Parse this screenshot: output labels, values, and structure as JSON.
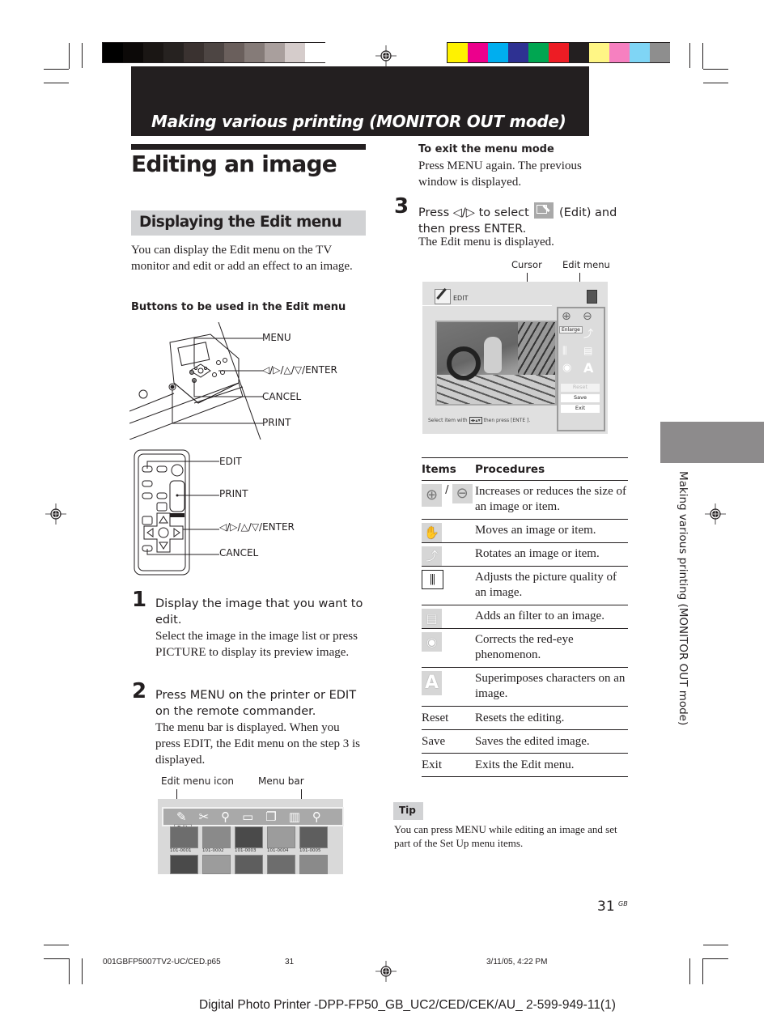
{
  "header": {
    "banner_title": "Making various printing (MONITOR OUT mode)",
    "gray_swatches": [
      "#000000",
      "#0c0908",
      "#1a1614",
      "#262220",
      "#3a3230",
      "#4d4543",
      "#6a5f5c",
      "#857b78",
      "#a99f9d",
      "#d5cccb",
      "#ffffff"
    ],
    "color_swatches": [
      "#fff200",
      "#ec008c",
      "#00aeef",
      "#2e3192",
      "#00a651",
      "#ed1c24",
      "#231f20",
      "#fff685",
      "#f680c0",
      "#7fd5f5",
      "#8e8e8e"
    ]
  },
  "left": {
    "title": "Editing an image",
    "section_title": "Displaying the Edit menu",
    "intro": "You can display the Edit menu on the TV monitor and edit or add an effect to an image.",
    "buttons_heading": "Buttons to be used in the Edit menu",
    "printer_labels": [
      "MENU",
      "◁/▷/△/▽/ENTER",
      "CANCEL",
      "PRINT"
    ],
    "remote_labels": [
      "EDIT",
      "PRINT",
      "◁/▷/△/▽/ENTER",
      "CANCEL"
    ],
    "remote_print_tag": "PRINT",
    "steps": [
      {
        "num": "1",
        "head": "Display the image that you want to edit.",
        "body": "Select the image in the image list or press  PICTURE to display its preview image."
      },
      {
        "num": "2",
        "head": "Press MENU on the printer or EDIT on the remote commander.",
        "body": "The menu bar is displayed.  When you press EDIT, the Edit menu on the step 3 is displayed."
      }
    ],
    "menubar_fig": {
      "label_icon": "Edit menu icon",
      "label_bar": "Menu bar",
      "edit_tooltip": "Edit",
      "thumbs": [
        "101-0001",
        "101-0002",
        "101-0003",
        "101-0004",
        "101-0005"
      ]
    }
  },
  "right": {
    "exit_heading": "To exit the menu mode",
    "exit_body": "Press MENU again.  The previous window is displayed.",
    "step3": {
      "num": "3",
      "head_a": "Press ◁/▷ to select",
      "head_b": "(Edit) and then press ENTER.",
      "body": "The Edit menu is displayed."
    },
    "edit_fig": {
      "label_cursor": "Cursor",
      "label_menu": "Edit menu",
      "screen_title": "EDIT",
      "tooltip": "Enlarge",
      "btn_reset": "Reset",
      "btn_save": "Save",
      "btn_exit": "Exit",
      "hint_a": "Select item with",
      "hint_b": "then press [ENTE ]."
    },
    "table": {
      "headers": [
        "Items",
        "Procedures"
      ],
      "rows": [
        {
          "icon": "zoom-in-out-icon",
          "item": "",
          "text": "Increases or reduces the size of an image or item."
        },
        {
          "icon": "hand-icon",
          "item": "",
          "text": "Moves an image or item."
        },
        {
          "icon": "rotate-icon",
          "item": "",
          "text": "Rotates an image or item."
        },
        {
          "icon": "sliders-icon",
          "item": "",
          "text": "Adjusts the picture quality of an image."
        },
        {
          "icon": "filter-icon",
          "item": "",
          "text": "Adds an filter to an image."
        },
        {
          "icon": "eye-icon",
          "item": "",
          "text": "Corrects the red-eye phenomenon."
        },
        {
          "icon": "letter-a-icon",
          "item": "",
          "text": "Superimposes characters on an image."
        },
        {
          "icon": "",
          "item": "Reset",
          "text": "Resets the editing."
        },
        {
          "icon": "",
          "item": "Save",
          "text": "Saves the edited image."
        },
        {
          "icon": "",
          "item": "Exit",
          "text": "Exits the Edit menu."
        }
      ],
      "zoom_sep": "/"
    },
    "tip_label": "Tip",
    "tip_text": "You can press MENU while editing an image and set part of the Set Up menu items."
  },
  "side_tab_text": "Making various printing  (MONITOR OUT mode)",
  "page_number": "31",
  "page_suffix": "GB",
  "footer": {
    "file": "001GBFP5007TV2-UC/CED.p65",
    "page": "31",
    "date": "3/11/05, 4:22 PM",
    "product": "Digital Photo Printer -DPP-FP50_GB_UC2/CED/CEK/AU_",
    "code": "2-599-949-11(1)"
  }
}
